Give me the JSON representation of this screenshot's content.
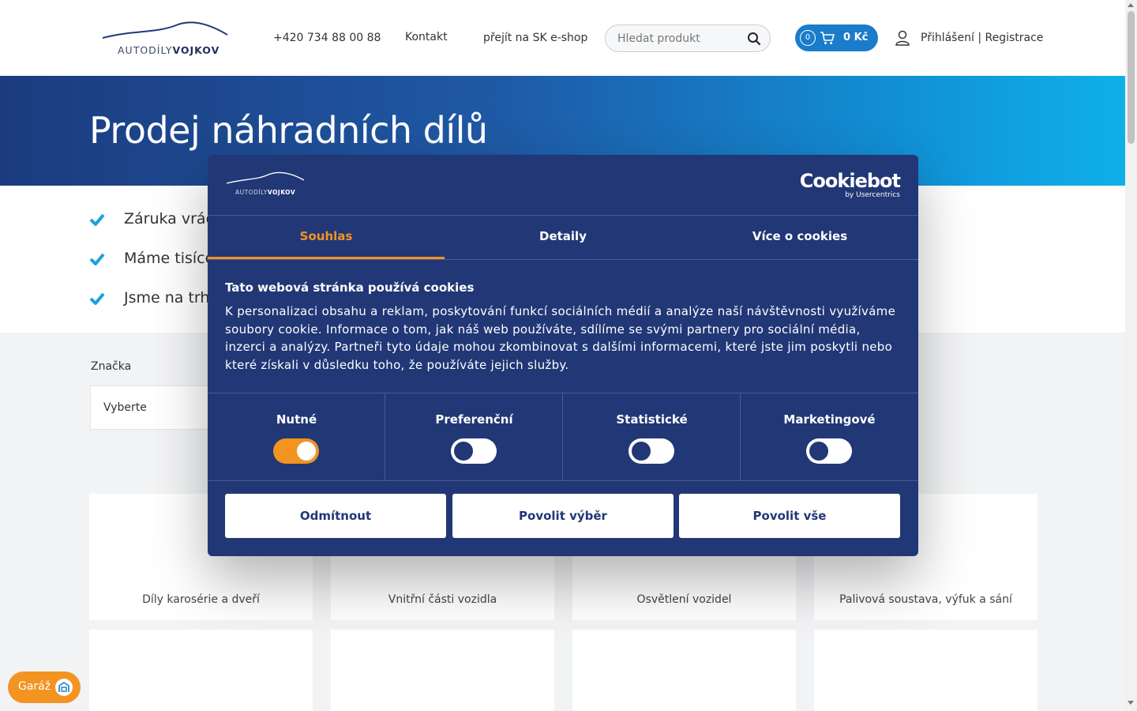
{
  "header": {
    "logo_text_light": "AUTODÍLY",
    "logo_text_bold": "VOJKOV",
    "phone": "+420 734 88 00 88",
    "contact": "Kontakt",
    "sk_shop": "přejít na SK e-shop",
    "search_placeholder": "Hledat produkt",
    "cart_count": "0",
    "cart_total": "0 Kč",
    "login": "Přihlášení",
    "separator": "|",
    "register": "Registrace"
  },
  "hero": {
    "title": "Prodej náhradních dílů"
  },
  "benefits": [
    "Záruka vrác",
    "Máme tisíce",
    "Jsme na trh"
  ],
  "filter": {
    "label": "Značka",
    "value": "Vyberte"
  },
  "categories": [
    "Díly karosérie a dveří",
    "Vnitřní části vozidla",
    "Osvětlení vozidel",
    "Palivová soustava, výfuk a sání"
  ],
  "garage": {
    "label": "Garáž"
  },
  "cookie": {
    "logo_light": "AUTODÍLY",
    "logo_bold": "VOJKOV",
    "brand": "Cookiebot",
    "brand_sub": "by Usercentrics",
    "tabs": [
      "Souhlas",
      "Detaily",
      "Více o cookies"
    ],
    "title": "Tato webová stránka používá cookies",
    "body": "K personalizaci obsahu a reklam, poskytování funkcí sociálních médií a analýze naší návštěvnosti využíváme soubory cookie. Informace o tom, jak náš web používáte, sdílíme se svými partnery pro sociální média, inzerci a analýzy. Partneři tyto údaje mohou zkombinovat s dalšími informacemi, které jste jim poskytli nebo které získali v důsledku toho, že používáte jejich služby.",
    "categories": [
      {
        "label": "Nutné",
        "enabled": true
      },
      {
        "label": "Preferenční",
        "enabled": false
      },
      {
        "label": "Statistické",
        "enabled": false
      },
      {
        "label": "Marketingové",
        "enabled": false
      }
    ],
    "buttons": [
      "Odmítnout",
      "Povolit výběr",
      "Povolit vše"
    ]
  },
  "colors": {
    "primary_dark": "#213776",
    "accent": "#f39322",
    "cart_blue": "#1a7ccb",
    "check_blue": "#1aa0dc"
  }
}
